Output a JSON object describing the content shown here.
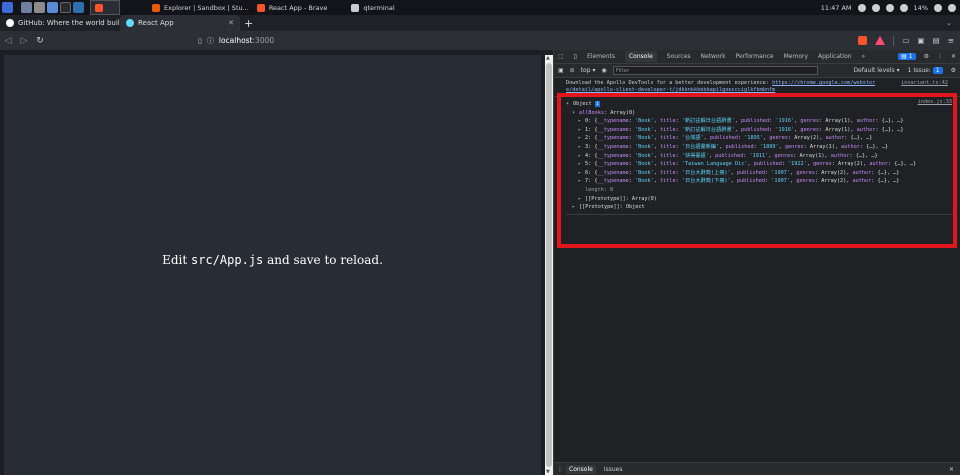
{
  "taskbar": {
    "apps": [
      {
        "label": "",
        "color": "#fb542b",
        "active": true
      },
      {
        "label": "Explorer | Sandbox | Stu...",
        "color": "#e8590c"
      },
      {
        "label": "React App - Brave",
        "color": "#fb542b"
      },
      {
        "label": "qterminal",
        "color": "#cccccc"
      }
    ],
    "clock": "11:47 AM",
    "battery": "14%"
  },
  "tabs": [
    {
      "label": "GitHub: Where the world buil",
      "fav_color": "#ffffff",
      "active": false
    },
    {
      "label": "React App",
      "fav_color": "#61dafb",
      "active": true
    }
  ],
  "urlbar": {
    "host": "localhost",
    "port": ":3000"
  },
  "page": {
    "prefix": "Edit ",
    "code": "src/App.js",
    "suffix": " and save to reload."
  },
  "devtools": {
    "tabs": [
      "Elements",
      "Console",
      "Sources",
      "Network",
      "Performance",
      "Memory",
      "Application"
    ],
    "active_tab": "Console",
    "more": "»",
    "msg_badge": "1",
    "context": "top",
    "filter_placeholder": "Filter",
    "levels": "Default levels",
    "issues": "1 Issue:",
    "issues_count": "1",
    "notice_text": "Download the Apollo DevTools for a better development experience: ",
    "notice_link1": "https://chrome.google.com/webstor",
    "notice_link2": "e/detail/apollo-client-developer-t/jdkknkkbebbapilgoeccciglkfbmbnfm",
    "notice_src": "invariant.ts:42",
    "console_src": "index.js:33",
    "tree": {
      "root": "Object",
      "allBooks_label": "allBooks",
      "allBooks_value": "Array(8)",
      "books": [
        "0: {__typename: 'Book', title: '新訂註解日台語辭書', published: '1916', genres: Array(1), author: {…}, …}",
        "1: {__typename: 'Book', title: '新訂註解日台語辭書', published: '1916', genres: Array(1), author: {…}, …}",
        "2: {__typename: 'Book', title: '台灣語', published: '1895', genres: Array(2), author: {…}, …}",
        "3: {__typename: 'Book', title: '日台語彙新編', published: '1899', genres: Array(1), author: {…}, …}",
        "4: {__typename: 'Book', title: '快得臺語', published: '1911', genres: Array(1), author: {…}, …}",
        "5: {__typename: 'Book', title: 'Taiwan Language Dic', published: '1922', genres: Array(2), author: {…}, …}",
        "6: {__typename: 'Book', title: '日台大辭典(上冊)', published: '1907', genres: Array(2), author: {…}, …}",
        "7: {__typename: 'Book', title: '日台大辭典(下冊)', published: '1907', genres: Array(2), author: {…}, …}"
      ],
      "length_line": "length: 8",
      "proto_array": "[[Prototype]]: Array(0)",
      "proto_object": "[[Prototype]]: Object"
    },
    "drawer_tabs": [
      "Console",
      "Issues"
    ]
  },
  "colors": {
    "highlight": "#e2161d",
    "page_bg": "#282c34"
  }
}
